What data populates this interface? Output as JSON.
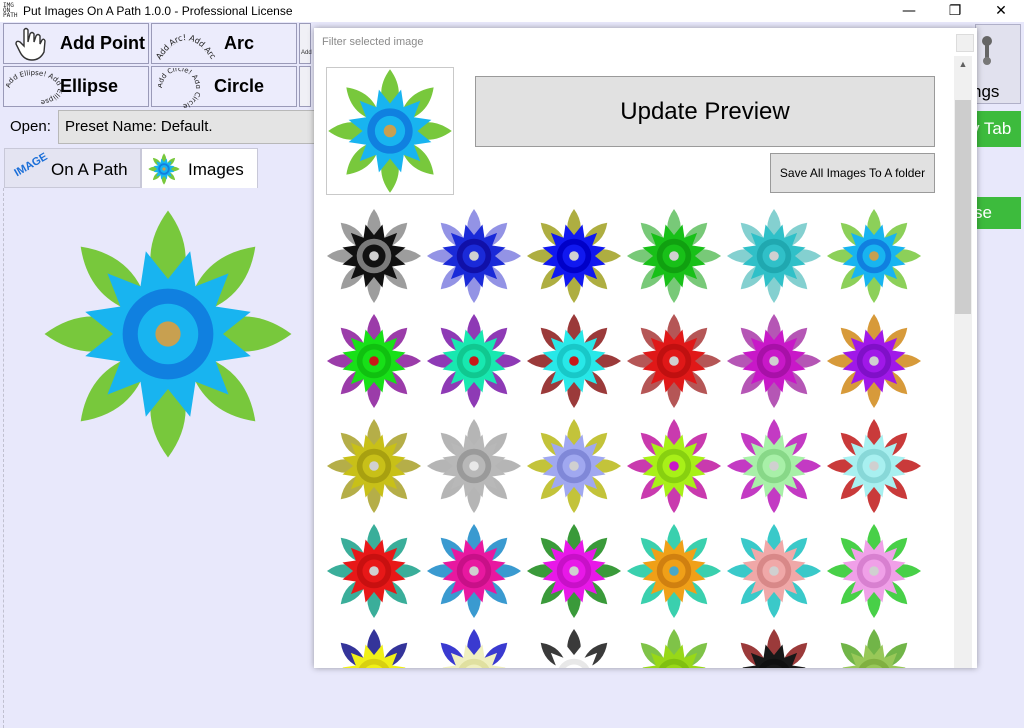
{
  "window": {
    "title": "Put Images On A Path 1.0.0 - Professional License",
    "icon_text": "IMG ON PATH",
    "controls": {
      "minimize": "—",
      "maximize": "❐",
      "close": "✕"
    }
  },
  "toolbar": {
    "add_point_label": "Add Point",
    "arc_label": "Arc",
    "arc_icon_text": "Add Arc! Add Arc",
    "ellipse_label": "Ellipse",
    "ellipse_icon_text": "Add Ellipse! Add Ellipse",
    "circle_label": "Circle",
    "circle_icon_text": "Add Circle! Add Circle",
    "add_small_text": "Add"
  },
  "open_label": "Open:",
  "preset_value": "Preset Name: Default.",
  "tabs": [
    {
      "label": "On A Path",
      "icon_text": "IMAGE",
      "selected": false
    },
    {
      "label": "Images",
      "selected": true
    }
  ],
  "right_side": {
    "settings_partial": "ngs",
    "new_tab_partial": "v Tab",
    "close_partial": "se"
  },
  "popup": {
    "filter_text": "Filter selected image",
    "update_label": "Update Preview",
    "save_all_label": "Save All Images To A folder"
  },
  "variants": [
    {
      "petal": "#111111",
      "center": "#7a7a7a",
      "leaf": "#8c8c8c",
      "dot": "#d0d0d0"
    },
    {
      "petal": "#1a2ad8",
      "center": "#1010a8",
      "leaf": "#8080e0",
      "dot": "#d0d0d0"
    },
    {
      "petal": "#1018f0",
      "center": "#0000c8",
      "leaf": "#a0a020",
      "dot": "#d0d0d0"
    },
    {
      "petal": "#18c018",
      "center": "#10a010",
      "leaf": "#60c060",
      "dot": "#d0d0d0"
    },
    {
      "petal": "#30c0c8",
      "center": "#20a8b0",
      "leaf": "#6ec8c8",
      "dot": "#d0d0d0"
    },
    {
      "petal": "#18b4f0",
      "center": "#1080e0",
      "leaf": "#78c83c",
      "dot": "#c8a050"
    },
    {
      "petal": "#18e018",
      "center": "#10c010",
      "leaf": "#8a1a9a",
      "dot": "#c81818"
    },
    {
      "petal": "#18e8b0",
      "center": "#10c890",
      "leaf": "#7a18a8",
      "dot": "#c81818"
    },
    {
      "petal": "#28e8e8",
      "center": "#18c8c8",
      "leaf": "#8a1818",
      "dot": "#c81818"
    },
    {
      "petal": "#e01818",
      "center": "#c01010",
      "leaf": "#a83838",
      "dot": "#d0d0d0"
    },
    {
      "petal": "#c818c8",
      "center": "#a810a8",
      "leaf": "#a838a8",
      "dot": "#d0d0d0"
    },
    {
      "petal": "#a018e8",
      "center": "#8010c8",
      "leaf": "#d08818",
      "dot": "#d0d0d0"
    },
    {
      "petal": "#c8c018",
      "center": "#a8a010",
      "leaf": "#a8a028",
      "dot": "#d0d0d0"
    },
    {
      "petal": "#b8b8b8",
      "center": "#9a9a9a",
      "leaf": "#a8a8a8",
      "dot": "#e8e8e8"
    },
    {
      "petal": "#a0a8f0",
      "center": "#8088d8",
      "leaf": "#b8b818",
      "dot": "#d0d0d0"
    },
    {
      "petal": "#a8f018",
      "center": "#88d010",
      "leaf": "#c018a0",
      "dot": "#c818c8"
    },
    {
      "petal": "#a8f0a8",
      "center": "#88d888",
      "leaf": "#b818b8",
      "dot": "#d0d0d0"
    },
    {
      "petal": "#a8f0f0",
      "center": "#88d8d8",
      "leaf": "#c01818",
      "dot": "#d0d0d0"
    },
    {
      "petal": "#e81818",
      "center": "#c81010",
      "leaf": "#18a088",
      "dot": "#d0d0d0"
    },
    {
      "petal": "#e818a0",
      "center": "#c81088",
      "leaf": "#1888c8",
      "dot": "#d0d0d0"
    },
    {
      "petal": "#e818e8",
      "center": "#c810c8",
      "leaf": "#188818",
      "dot": "#d0d0d0"
    },
    {
      "petal": "#f0a018",
      "center": "#d08010",
      "leaf": "#18c8a0",
      "dot": "#48a8c8"
    },
    {
      "petal": "#f0a8a8",
      "center": "#d88888",
      "leaf": "#18c0c0",
      "dot": "#d0d0d0"
    },
    {
      "petal": "#f0a0e8",
      "center": "#d880d0",
      "leaf": "#28c828",
      "dot": "#d0d0d0"
    },
    {
      "petal": "#f0f018",
      "center": "#d8d010",
      "leaf": "#101088",
      "dot": "#d0d0d0"
    },
    {
      "petal": "#f0f0c0",
      "center": "#e0e0a0",
      "leaf": "#1818c8",
      "dot": "#d0d0d0"
    },
    {
      "petal": "#ffffff",
      "center": "#e8e8e8",
      "leaf": "#181818",
      "dot": "#d0d0d0"
    },
    {
      "petal": "#98d818",
      "center": "#80c010",
      "leaf": "#68b828",
      "dot": "#d0d0d0"
    },
    {
      "petal": "#181818",
      "center": "#101010",
      "leaf": "#8a1818",
      "dot": "#d0d0d0"
    },
    {
      "petal": "#98c858",
      "center": "#80b040",
      "leaf": "#58a828",
      "dot": "#d0d0d0"
    }
  ]
}
